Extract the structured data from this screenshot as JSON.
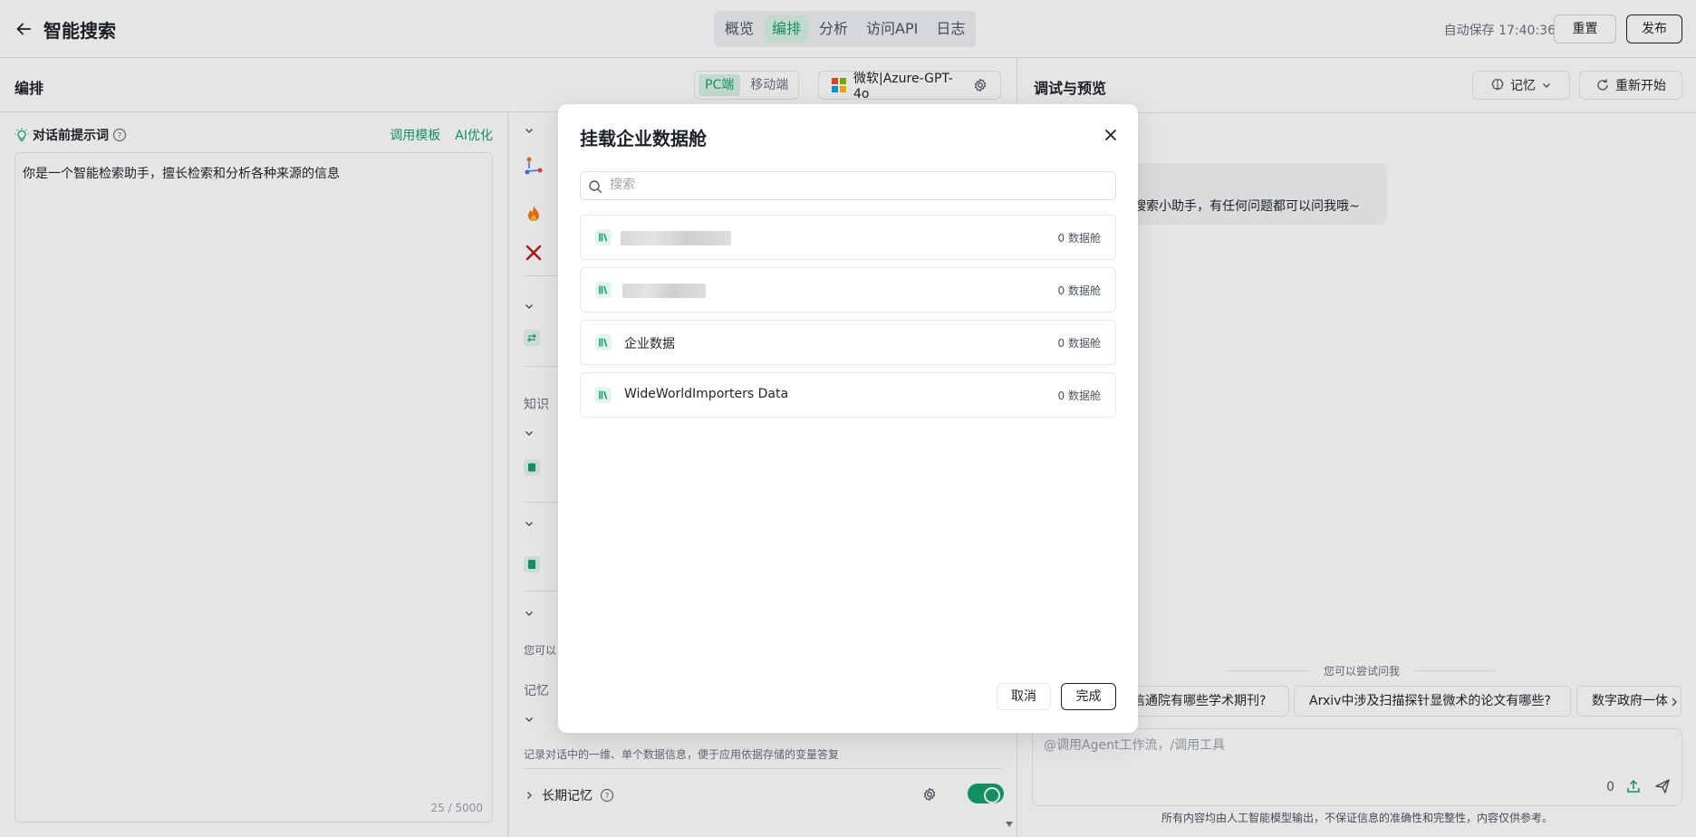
{
  "header": {
    "title": "智能搜索",
    "tabs": [
      {
        "label": "概览"
      },
      {
        "label": "编排",
        "active": true
      },
      {
        "label": "分析"
      },
      {
        "label": "访问API"
      },
      {
        "label": "日志"
      }
    ],
    "autosave": "自动保存 17:40:36",
    "reset_label": "重置",
    "publish_label": "发布"
  },
  "editor": {
    "title": "编排",
    "device_options": [
      "PC端",
      "移动端"
    ],
    "model_name": "微软|Azure-GPT-4o"
  },
  "prompt": {
    "title": "对话前提示词",
    "template_link": "调用模板",
    "ai_optimize_link": "AI优化",
    "content": "你是一个智能检索助手，擅长检索和分析各种来源的信息",
    "char_count": "25 / 5000"
  },
  "config": {
    "knowledge_label": "知识",
    "mount_note": "您可以",
    "memory_label": "记忆",
    "memory_note": "记录对话中的一维、单个数据信息，便于应用依据存储的变量答复",
    "long_term_memory": "长期记忆"
  },
  "preview": {
    "title": "调试与预览",
    "memory_label": "记忆",
    "restart_label": "重新开始",
    "welcome_text": "搜索小助手，有任何问题都可以问我哦~",
    "suggest_label": "您可以尝试问我",
    "suggestions": [
      "信通院有哪些学术期刊?",
      "Arxiv中涉及扫描探针显微术的论文有哪些?",
      "数字政府一体"
    ],
    "input_placeholder": "@调用Agent工作流，/调用工具",
    "token_count": "0",
    "disclaimer": "所有内容均由人工智能模型输出，不保证信息的准确性和完整性，内容仅供参考。"
  },
  "modal": {
    "title": "挂载企业数据舱",
    "search_placeholder": "搜索",
    "items": [
      {
        "name": "",
        "count": "0 数据舱",
        "redacted": true
      },
      {
        "name": "",
        "count": "0 数据舱",
        "redacted": true
      },
      {
        "name": "企业数据",
        "count": "0 数据舱"
      },
      {
        "name": "WideWorldImporters Data",
        "count": "0 数据舱"
      }
    ],
    "cancel_label": "取消",
    "done_label": "完成"
  },
  "colors": {
    "accent": "#16a16d",
    "accent_bg": "#d8f3e6"
  }
}
